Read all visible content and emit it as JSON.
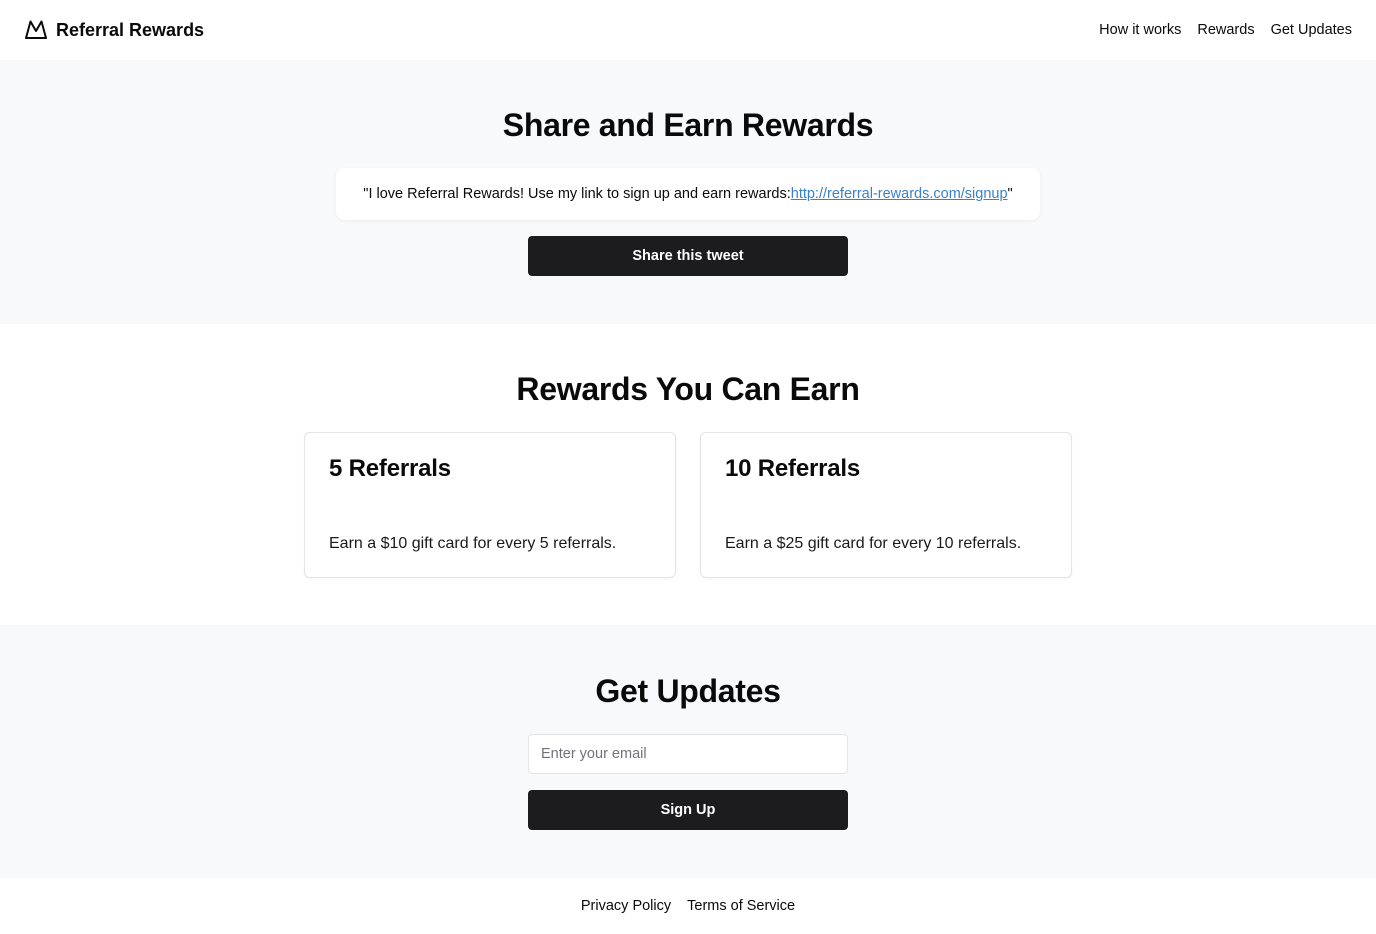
{
  "header": {
    "brand": "Referral Rewards",
    "nav": [
      "How it works",
      "Rewards",
      "Get Updates"
    ]
  },
  "share": {
    "title": "Share and Earn Rewards",
    "tweet_prefix": "\"I love Referral Rewards! Use my link to sign up and earn rewards: ",
    "tweet_link": "http://referral-rewards.com/signup",
    "tweet_suffix": "\"",
    "button": "Share this tweet"
  },
  "rewards": {
    "title": "Rewards You Can Earn",
    "cards": [
      {
        "title": "5 Referrals",
        "desc": "Earn a $10 gift card for every 5 referrals."
      },
      {
        "title": "10 Referrals",
        "desc": "Earn a $25 gift card for every 10 referrals."
      }
    ]
  },
  "updates": {
    "title": "Get Updates",
    "email_placeholder": "Enter your email",
    "button": "Sign Up"
  },
  "footer": {
    "links": [
      "Privacy Policy",
      "Terms of Service"
    ]
  },
  "colors": {
    "section_bg": "#f8f9fa",
    "button_bg": "#1c1c1e",
    "link": "#3b82c4"
  },
  "icons": {
    "brand": "mountain-icon"
  }
}
